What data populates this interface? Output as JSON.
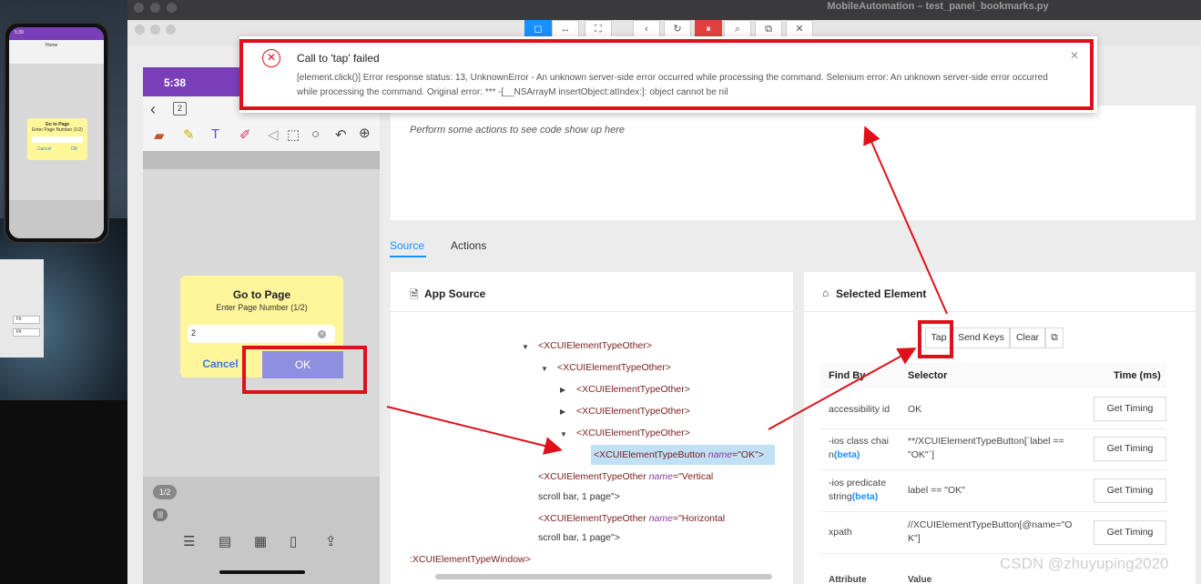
{
  "window": {
    "title": "MobileAutomation – test_panel_bookmarks.py"
  },
  "mini_phone": {
    "time": "5:39",
    "nav_title": "Home",
    "dialog_title": "Go to Page",
    "dialog_sub": "Enter Page Number (1/2)",
    "dialog_cancel": "Cancel",
    "dialog_ok": "OK"
  },
  "mac_panel": {
    "fit1": "Fit",
    "fit2": "Fit"
  },
  "phone": {
    "time": "5:38",
    "page_field": "2",
    "page_badge": "1/2",
    "scroll_badge": "|||",
    "dialog": {
      "title": "Go to Page",
      "subtitle": "Enter Page Number (1/2)",
      "input_value": "2",
      "cancel_label": "Cancel",
      "ok_label": "OK"
    }
  },
  "error": {
    "title": "Call to 'tap' failed",
    "body": "[element.click()] Error response status: 13, UnknownError - An unknown server-side error occurred while processing the command. Selenium error: An unknown server-side error occurred while processing the command. Original error: *** -[__NSArrayM insertObject:atIndex:]: object cannot be nil"
  },
  "recorder": {
    "placeholder": "Perform some actions to see code show up here"
  },
  "tabs": {
    "source": "Source",
    "actions": "Actions"
  },
  "app_source": {
    "title": "App Source",
    "nodes": [
      {
        "text": "<XCUIElementTypeOther>"
      },
      {
        "text": "<XCUIElementTypeOther>"
      },
      {
        "text": "<XCUIElementTypeOther>"
      },
      {
        "text": "<XCUIElementTypeOther>"
      },
      {
        "text": "<XCUIElementTypeOther>"
      },
      {
        "tag": "<XCUIElementTypeButton ",
        "attr": "name",
        "val": "=\"OK\">"
      },
      {
        "tag": "<XCUIElementTypeOther ",
        "attr": "name",
        "val": "=\"Vertical",
        "cont": "scroll bar, 1 page\">"
      },
      {
        "tag": "<XCUIElementTypeOther ",
        "attr": "name",
        "val": "=\"Horizontal",
        "cont": "scroll bar, 1 page\">"
      },
      {
        "text": ":XCUIElementTypeWindow>"
      }
    ]
  },
  "selected_element": {
    "title": "Selected Element",
    "buttons": {
      "tap": "Tap",
      "send_keys": "Send Keys",
      "clear": "Clear"
    },
    "headers": {
      "find_by": "Find By",
      "selector": "Selector",
      "time": "Time (ms)"
    },
    "rows": [
      {
        "find_by": "accessibility id",
        "selector": "OK"
      },
      {
        "find_by_a": "-ios class chai",
        "find_by_b": "n",
        "beta": "(beta)",
        "selector_a": "**/XCUIElementTypeButton[`label ==",
        "selector_b": "\"OK\"`]"
      },
      {
        "find_by_a": "-ios predicate",
        "find_by_b": "string",
        "beta": "(beta)",
        "selector": "label == \"OK\""
      },
      {
        "find_by": "xpath",
        "selector_a": "//XCUIElementTypeButton[@name=\"O",
        "selector_b": "K\"]"
      }
    ],
    "timing_label": "Get Timing",
    "attr_headers": {
      "attribute": "Attribute",
      "value": "Value"
    }
  },
  "watermark": "CSDN @zhuyuping2020",
  "colors": {
    "accent": "#1890ff",
    "error": "#e0101a",
    "phone_header": "#7a3fb8",
    "dialog_bg": "#fff59a",
    "ok_button": "#8f8fe0"
  }
}
